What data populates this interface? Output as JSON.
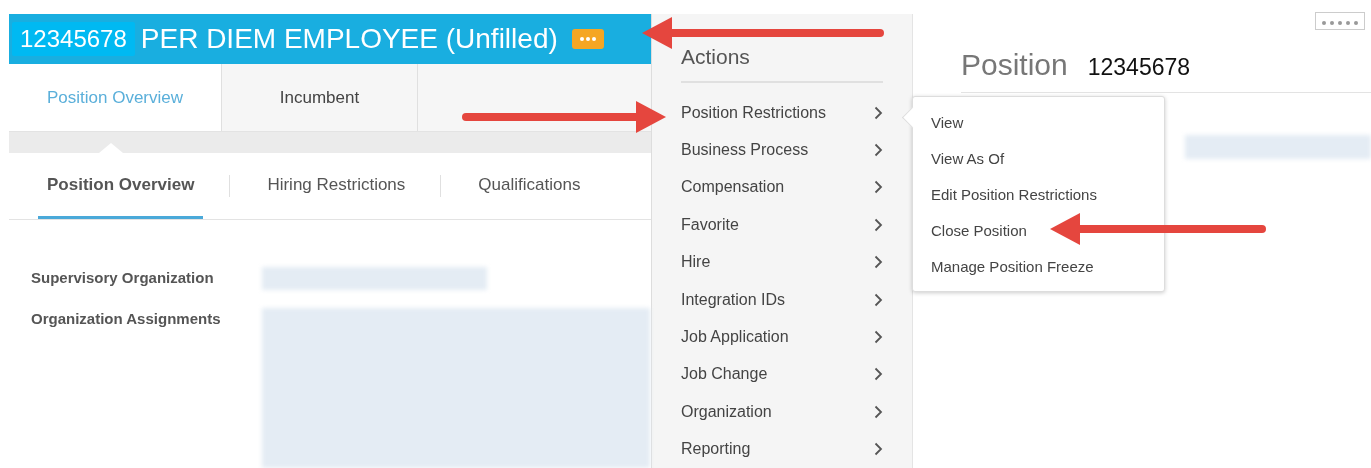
{
  "header": {
    "id": "12345678",
    "title": "PER DIEM EMPLOYEE (Unfilled)"
  },
  "tabs": [
    {
      "label": "Position Overview",
      "selected": true
    },
    {
      "label": "Incumbent",
      "selected": false
    }
  ],
  "subtabs": [
    {
      "label": "Position Overview",
      "selected": true
    },
    {
      "label": "Hiring Restrictions",
      "selected": false
    },
    {
      "label": "Qualifications",
      "selected": false
    }
  ],
  "fields": [
    {
      "label": "Supervisory Organization",
      "kind": "single"
    },
    {
      "label": "Organization Assignments",
      "kind": "multi"
    }
  ],
  "actions_menu": {
    "title": "Actions",
    "items": [
      "Position Restrictions",
      "Business Process",
      "Compensation",
      "Favorite",
      "Hire",
      "Integration IDs",
      "Job Application",
      "Job Change",
      "Organization",
      "Reporting"
    ]
  },
  "submenu": {
    "items": [
      "View",
      "View As Of",
      "Edit Position Restrictions",
      "Close Position",
      "Manage Position Freeze"
    ]
  },
  "position_panel": {
    "label": "Position",
    "value": "12345678"
  }
}
